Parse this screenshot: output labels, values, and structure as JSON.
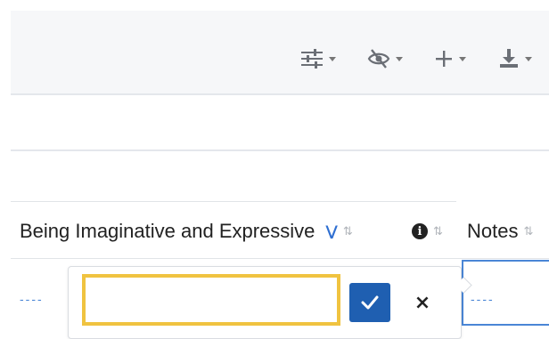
{
  "toolbar": {
    "icons": [
      "sliders-icon",
      "hide-columns-icon",
      "add-icon",
      "download-icon"
    ]
  },
  "columns": [
    {
      "label": "Being Imaginative and Expressive",
      "has_filter_chevron": true,
      "sort_glyph": "⇅"
    },
    {
      "label": "",
      "has_info_icon": true,
      "info_glyph": "i",
      "sort_glyph": "⇅"
    },
    {
      "label": "Notes",
      "sort_glyph": "⇅"
    }
  ],
  "row": {
    "left_cell_placeholder": "----",
    "notes_cell_placeholder": "----"
  },
  "editor": {
    "value": "",
    "confirm_glyph": "✓",
    "cancel_glyph": "×"
  },
  "colors": {
    "accent_blue": "#1f5fb1",
    "focus_yellow": "#f0c340",
    "link_blue": "#4a86d6"
  }
}
